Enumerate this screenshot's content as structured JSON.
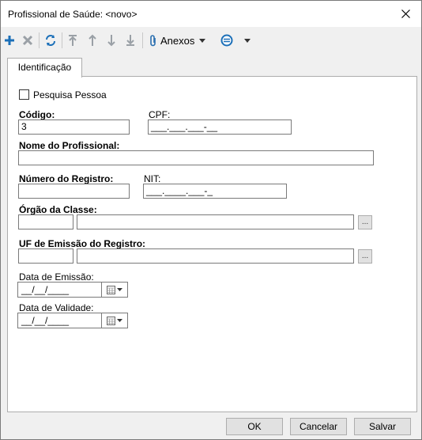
{
  "window": {
    "title": "Profissional de Saúde: <novo>"
  },
  "toolbar": {
    "anexos_label": "Anexos"
  },
  "tabs": [
    {
      "label": "Identificação"
    }
  ],
  "form": {
    "pesquisa_pessoa": {
      "label": "Pesquisa Pessoa",
      "checked": false
    },
    "codigo": {
      "label": "Código:",
      "value": "3"
    },
    "cpf": {
      "label": "CPF:",
      "value": "___.___.___-__"
    },
    "nome": {
      "label": "Nome do Profissional:",
      "value": ""
    },
    "numero_registro": {
      "label": "Número do Registro:",
      "value": ""
    },
    "nit": {
      "label": "NIT:",
      "value": "___.____.___-_"
    },
    "orgao_classe": {
      "label": "Órgão da Classe:",
      "code": "",
      "description": "",
      "lookup": "..."
    },
    "uf_emissao": {
      "label": "UF de Emissão do Registro:",
      "code": "",
      "description": "",
      "lookup": "..."
    },
    "data_emissao": {
      "label": "Data de Emissão:",
      "value": "__/__/____"
    },
    "data_validade": {
      "label": "Data de Validade:",
      "value": "__/__/____"
    }
  },
  "buttons": {
    "ok": "OK",
    "cancelar": "Cancelar",
    "salvar": "Salvar"
  }
}
